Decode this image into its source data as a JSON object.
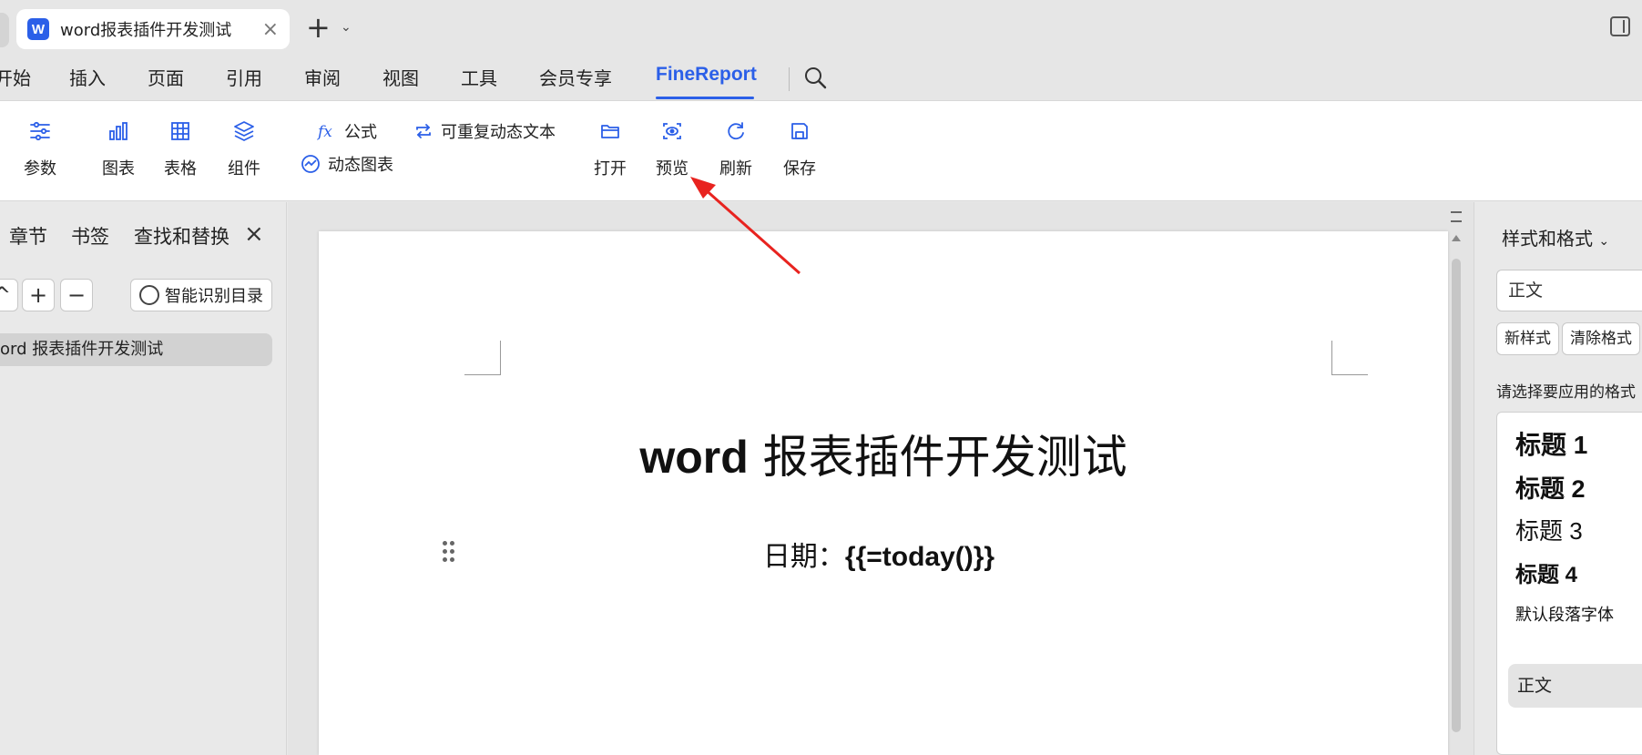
{
  "window": {
    "tab_title": "word报表插件开发测试",
    "tab_icon_letter": "W",
    "tab_close": "×",
    "new_tab": "+",
    "tab_dropdown": "⌄"
  },
  "menu": {
    "items": [
      "开始",
      "插入",
      "页面",
      "引用",
      "审阅",
      "视图",
      "工具",
      "会员专享",
      "FineReport"
    ],
    "active": "FineReport"
  },
  "ribbon": {
    "params": "参数",
    "chart": "图表",
    "table": "表格",
    "component": "组件",
    "formula": "公式",
    "repeat_text": "可重复动态文本",
    "dynamic_chart": "动态图表",
    "open": "打开",
    "preview": "预览",
    "refresh": "刷新",
    "save": "保存"
  },
  "nav_panel": {
    "tabs": [
      "章节",
      "书签",
      "查找和替换"
    ],
    "close": "×",
    "up": "^",
    "add": "+",
    "remove": "−",
    "smart_toc": "智能识别目录",
    "toc_item": "ord 报表插件开发测试"
  },
  "document": {
    "title_en": "word",
    "title_cn": " 报表插件开发测试",
    "date_label": "日期：",
    "date_expr": "{{=today()}}"
  },
  "styles_panel": {
    "header": "样式和格式",
    "current_style": "正文",
    "new_style": "新样式",
    "clear_format": "清除格式",
    "apply_label": "请选择要应用的格式",
    "items": [
      "标题  1",
      "标题  2",
      "标题  3",
      "标题  4",
      "默认段落字体",
      "正文"
    ]
  },
  "colors": {
    "accent": "#2b5fe8",
    "arrow": "#e8231f"
  }
}
